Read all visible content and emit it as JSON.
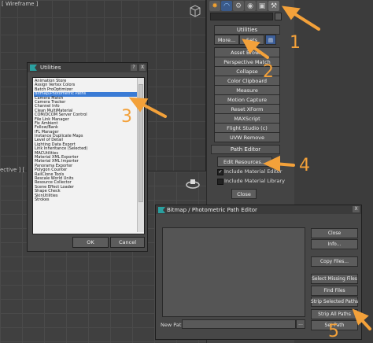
{
  "viewport_top": {
    "label": "[ Wireframe ]"
  },
  "viewport_bottom": {
    "label": "ective ] [ Real"
  },
  "command_panel": {
    "tabs": [
      "create",
      "modify",
      "hierarchy",
      "motion",
      "display",
      "utilities"
    ],
    "utilities_rollout": {
      "title": "Utilities",
      "more_label": "More...",
      "sets_label": "Sets",
      "buttons": [
        "Asset Brow...",
        "Perspective Match",
        "Collapse",
        "Color Clipboard",
        "Measure",
        "Motion Capture",
        "Reset XForm",
        "MAXScript",
        "Flight Studio (c)",
        "UVW Remove"
      ]
    },
    "path_editor_rollout": {
      "title": "Path Editor",
      "edit_resources_label": "Edit Resources...",
      "include_material_editor": {
        "label": "Include Material Editor",
        "checked": true
      },
      "include_material_library": {
        "label": "Include Material Library",
        "checked": false
      },
      "close_label": "Close"
    }
  },
  "utilities_dialog": {
    "title": "Utilities",
    "help_label": "?",
    "close_label": "X",
    "items": [
      "Animation Store",
      "Assign Vertex Colors",
      "Batch ProOptimizer",
      "Bitmap/Photometric Paths",
      "Camera Match",
      "Camera Tracker",
      "Channel Info",
      "Clean MultiMaterial",
      "COM/DCOM Server Control",
      "File Link Manager",
      "Fix Ambient",
      "Follow/Bank",
      "IFL Manager",
      "Instance Duplicate Maps",
      "Level of Detail",
      "Lighting Data Export",
      "Link Inheritance (Selected)",
      "MACUtilities",
      "Material XML Exporter",
      "Material XML Importer",
      "Panorama Exporter",
      "Polygon Counter",
      "RailClone Tools",
      "Rescale World Units",
      "Resource Collector",
      "Scene Effect Loader",
      "Shape Check",
      "SkinUtilities",
      "Strokes"
    ],
    "selected_index": 3,
    "ok_label": "OK",
    "cancel_label": "Cancel"
  },
  "path_editor_dialog": {
    "title": "Bitmap / Photometric Path Editor",
    "close_label": "X",
    "buttons": [
      "Close",
      "Info...",
      "Copy Files...",
      "Select Missing Files",
      "Find Files",
      "Strip Selected Paths",
      "Strip All Paths",
      "Set Path"
    ],
    "new_path_label": "New Path:",
    "new_path_value": "",
    "browse_label": "..."
  },
  "callouts": [
    "1",
    "2",
    "3",
    "4",
    "5"
  ],
  "colors": {
    "accent_orange": "#f3a13a",
    "selection_blue": "#3a7bd5"
  }
}
